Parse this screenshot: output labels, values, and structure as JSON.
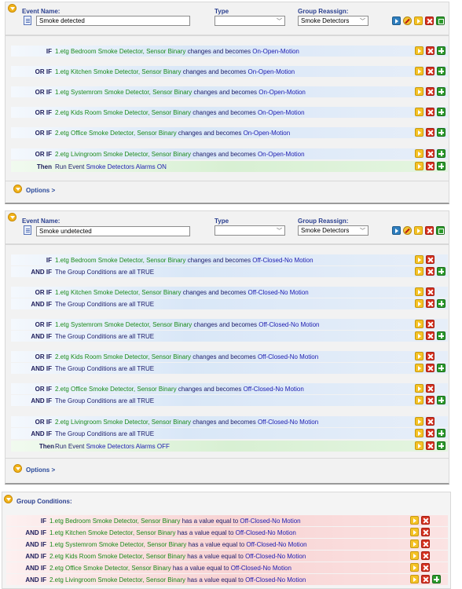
{
  "labels": {
    "event_name": "Event Name:",
    "type": "Type",
    "group_reassign": "Group Reassign:",
    "options": "Options >",
    "group_conditions": "Group Conditions:"
  },
  "events": [
    {
      "name": "Smoke detected",
      "type": "",
      "group": "Smoke Detectors",
      "rows": [
        {
          "kw": "IF",
          "dev": "1.etg Bedroom Smoke Detector",
          "sensor": "Sensor Binary",
          "mid": "changes and becomes",
          "val": "On-Open-Motion"
        },
        {
          "kw": "OR IF",
          "dev": "1.etg Kitchen Smoke Detector",
          "sensor": "Sensor Binary",
          "mid": "changes and becomes",
          "val": "On-Open-Motion"
        },
        {
          "kw": "OR IF",
          "dev": "1.etg Systemrom Smoke Detector",
          "sensor": "Sensor Binary",
          "mid": "changes and becomes",
          "val": "On-Open-Motion"
        },
        {
          "kw": "OR IF",
          "dev": "2.etg Kids Room Smoke Detector",
          "sensor": "Sensor Binary",
          "mid": "changes and becomes",
          "val": "On-Open-Motion"
        },
        {
          "kw": "OR IF",
          "dev": "2.etg Office Smoke Detector",
          "sensor": "Sensor Binary",
          "mid": "changes and becomes",
          "val": "On-Open-Motion"
        },
        {
          "kw": "OR IF",
          "dev": "2.etg Livingroom Smoke Detector",
          "sensor": "Sensor Binary",
          "mid": "changes and becomes",
          "val": "On-Open-Motion"
        }
      ],
      "then": {
        "kw": "Then",
        "pre": "Run Event",
        "target": "Smoke Detectors Alarms ON"
      }
    },
    {
      "name": "Smoke undetected",
      "type": "",
      "group": "Smoke Detectors",
      "rows": [
        {
          "kw": "IF",
          "dev": "1.etg Bedroom Smoke Detector",
          "sensor": "Sensor Binary",
          "mid": "changes and becomes",
          "val": "Off-Closed-No Motion"
        },
        {
          "kw": "AND IF",
          "text": "The Group Conditions are all TRUE"
        },
        {
          "kw": "OR IF",
          "dev": "1.etg Kitchen Smoke Detector",
          "sensor": "Sensor Binary",
          "mid": "changes and becomes",
          "val": "Off-Closed-No Motion"
        },
        {
          "kw": "AND IF",
          "text": "The Group Conditions are all TRUE"
        },
        {
          "kw": "OR IF",
          "dev": "1.etg Systemrom Smoke Detector",
          "sensor": "Sensor Binary",
          "mid": "changes and becomes",
          "val": "Off-Closed-No Motion"
        },
        {
          "kw": "AND IF",
          "text": "The Group Conditions are all TRUE"
        },
        {
          "kw": "OR IF",
          "dev": "2.etg Kids Room Smoke Detector",
          "sensor": "Sensor Binary",
          "mid": "changes and becomes",
          "val": "Off-Closed-No Motion"
        },
        {
          "kw": "AND IF",
          "text": "The Group Conditions are all TRUE"
        },
        {
          "kw": "OR IF",
          "dev": "2.etg Office Smoke Detector",
          "sensor": "Sensor Binary",
          "mid": "changes and becomes",
          "val": "Off-Closed-No Motion"
        },
        {
          "kw": "AND IF",
          "text": "The Group Conditions are all TRUE"
        },
        {
          "kw": "OR IF",
          "dev": "2.etg Livingroom Smoke Detector",
          "sensor": "Sensor Binary",
          "mid": "changes and becomes",
          "val": "Off-Closed-No Motion"
        },
        {
          "kw": "AND IF",
          "text": "The Group Conditions are all TRUE"
        }
      ],
      "then": {
        "kw": "Then",
        "pre": "Run Event",
        "target": "Smoke Detectors Alarms OFF"
      }
    }
  ],
  "group_conditions": [
    {
      "kw": "IF",
      "dev": "1.etg Bedroom Smoke Detector",
      "sensor": "Sensor Binary",
      "mid": "has a value equal to",
      "val": "Off-Closed-No Motion"
    },
    {
      "kw": "AND IF",
      "dev": "1.etg Kitchen Smoke Detector",
      "sensor": "Sensor Binary",
      "mid": "has a value equal to",
      "val": "Off-Closed-No Motion"
    },
    {
      "kw": "AND IF",
      "dev": "1.etg Systemrom Smoke Detector",
      "sensor": "Sensor Binary",
      "mid": "has a value equal to",
      "val": "Off-Closed-No Motion"
    },
    {
      "kw": "AND IF",
      "dev": "2.etg Kids Room Smoke Detector",
      "sensor": "Sensor Binary",
      "mid": "has a value equal to",
      "val": "Off-Closed-No Motion"
    },
    {
      "kw": "AND IF",
      "dev": "2.etg Office Smoke Detector",
      "sensor": "Sensor Binary",
      "mid": "has a value equal to",
      "val": "Off-Closed-No Motion"
    },
    {
      "kw": "AND IF",
      "dev": "2.etg Livingroom Smoke Detector",
      "sensor": "Sensor Binary",
      "mid": "has a value equal to",
      "val": "Off-Closed-No Motion"
    }
  ],
  "sep": ", "
}
